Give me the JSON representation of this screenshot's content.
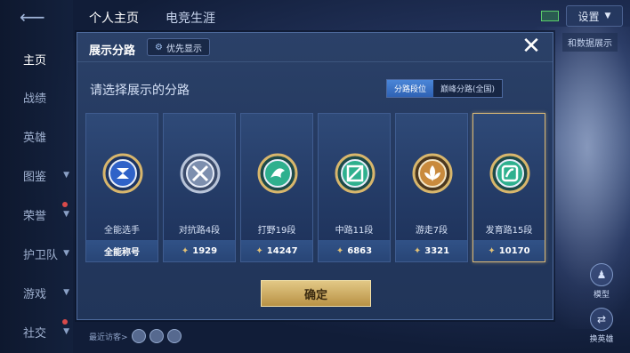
{
  "topbar": {
    "tabs": [
      {
        "label": "个人主页",
        "active": true
      },
      {
        "label": "电竞生涯",
        "active": false
      }
    ],
    "settings_label": "设置",
    "side_button_label": "和数据展示"
  },
  "sidebar": {
    "items": [
      {
        "label": "主页",
        "active": true
      },
      {
        "label": "战绩"
      },
      {
        "label": "英雄"
      },
      {
        "label": "图鉴"
      },
      {
        "label": "荣誉"
      },
      {
        "label": "护卫队"
      },
      {
        "label": "游戏"
      },
      {
        "label": "社交"
      }
    ]
  },
  "right_actions": {
    "model_label": "模型",
    "change_hero_label": "换英雄"
  },
  "bottom": {
    "visitors_label": "最近访客>"
  },
  "modal": {
    "title": "展示分路",
    "priority_label": "优先显示",
    "subtitle": "请选择展示的分路",
    "segments": [
      {
        "label": "分路段位",
        "active": true
      },
      {
        "label": "巅峰分路(全国)",
        "active": false
      }
    ],
    "cards": [
      {
        "label": "全能选手",
        "foot": "全能称号",
        "icon": "all-rounder-emblem",
        "color": "#3c6fd6",
        "selected": false,
        "has_points": false
      },
      {
        "label": "对抗路4段",
        "foot": "1929",
        "icon": "clash-lane-emblem",
        "color": "#7d8fae",
        "selected": false,
        "has_points": true
      },
      {
        "label": "打野19段",
        "foot": "14247",
        "icon": "jungle-emblem",
        "color": "#2fb08e",
        "selected": false,
        "has_points": true
      },
      {
        "label": "中路11段",
        "foot": "6863",
        "icon": "mid-lane-emblem",
        "color": "#2fb08e",
        "selected": false,
        "has_points": true
      },
      {
        "label": "游走7段",
        "foot": "3321",
        "icon": "roam-emblem",
        "color": "#c98a3d",
        "selected": false,
        "has_points": true
      },
      {
        "label": "发育路15段",
        "foot": "10170",
        "icon": "farm-lane-emblem",
        "color": "#2fb08e",
        "selected": true,
        "has_points": true
      }
    ],
    "confirm_label": "确定"
  }
}
